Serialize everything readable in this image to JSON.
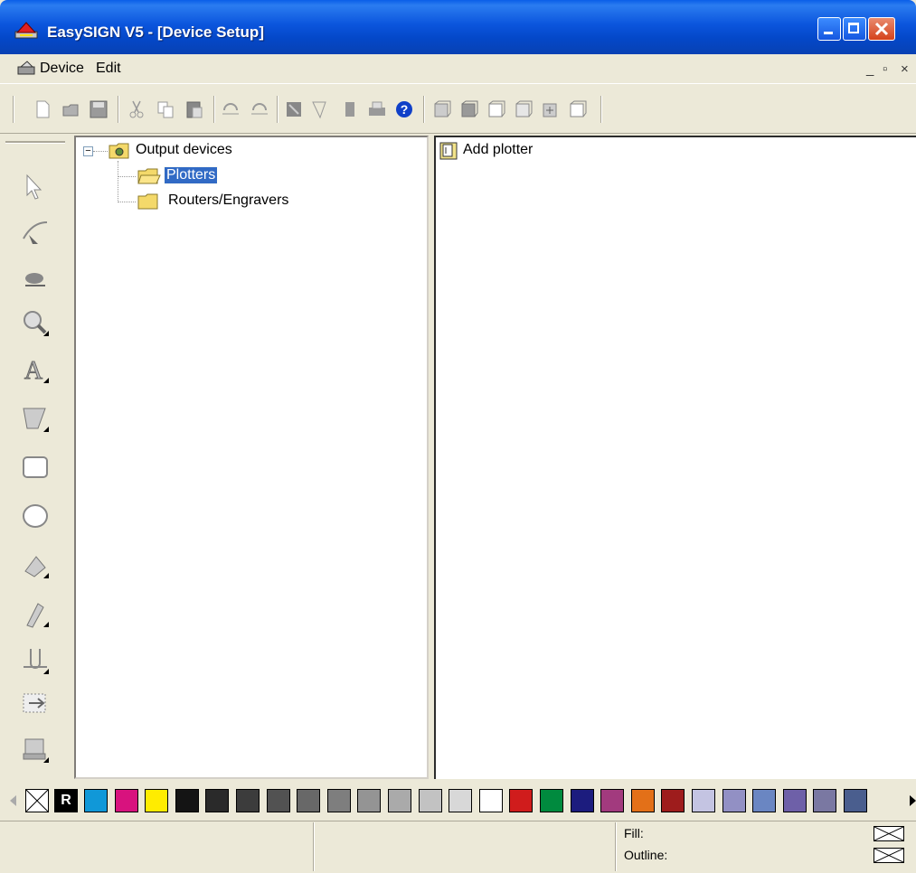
{
  "window": {
    "title": "EasySIGN V5 - [Device Setup]"
  },
  "menu": {
    "items": [
      "Device",
      "Edit"
    ],
    "mdi_controls": [
      "_",
      "▫",
      "×"
    ]
  },
  "toolbar": {
    "icons": [
      "new-icon",
      "open-icon",
      "save-icon",
      "cut-icon",
      "copy-icon",
      "paste-icon",
      "undo-icon",
      "redo-icon",
      "import-icon",
      "export-icon",
      "pause-icon",
      "print-icon",
      "help-icon",
      "view-front-icon",
      "view-back-icon",
      "view-left-icon",
      "view-right-icon",
      "view-top-icon",
      "view-3d-icon"
    ]
  },
  "tree": {
    "root_label": "Output devices",
    "root_expander": "−",
    "children": [
      {
        "label": "Plotters",
        "selected": true
      },
      {
        "label": "Routers/Engravers",
        "selected": false
      }
    ]
  },
  "list": {
    "items": [
      {
        "label": "Add plotter"
      }
    ]
  },
  "palette": {
    "none_symbol": "×",
    "registration_label": "R",
    "colors": [
      "#1098d8",
      "#d8127e",
      "#ffec00",
      "#141414",
      "#2a2a2a",
      "#3c3c3c",
      "#525252",
      "#686868",
      "#7e7e7e",
      "#949494",
      "#aaaaaa",
      "#c2c2c2",
      "#d8d8d8",
      "#ffffff",
      "#d01c1c",
      "#008a3e",
      "#1c1c7e",
      "#a23a7e",
      "#e37018",
      "#9e1c1c",
      "#c4c4e2",
      "#9290c4",
      "#6a86c2",
      "#6e60a8",
      "#7a78a2",
      "#4a5e8e"
    ]
  },
  "status": {
    "fill_label": "Fill:",
    "outline_label": "Outline:"
  }
}
